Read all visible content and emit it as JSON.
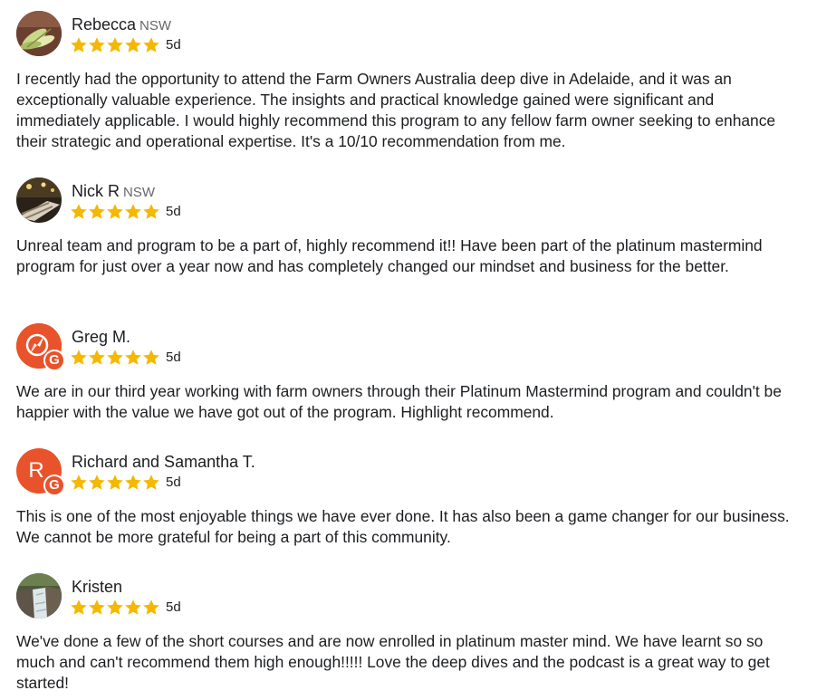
{
  "reviews": [
    {
      "name": "Rebecca",
      "region": "NSW",
      "rating": 5,
      "age": "5d",
      "avatar_icon": "leaves-photo-avatar",
      "text": "I recently had the opportunity to attend the Farm Owners Australia deep dive in Adelaide, and it was an exceptionally valuable experience. The insights and practical knowledge gained were significant and immediately applicable. I would highly recommend this program to any fellow farm owner seeking to enhance their strategic and operational expertise. It's a 10/10 recommendation from me."
    },
    {
      "name": "Nick R",
      "region": "NSW",
      "rating": 5,
      "age": "5d",
      "avatar_icon": "dark-photo-avatar",
      "text": "Unreal team and program to be a part of, highly recommend it!! Have been part of the platinum mastermind program for just over a year now and has completely changed our mindset and business for the better."
    },
    {
      "name": "Greg M.",
      "region": "",
      "rating": 5,
      "age": "5d",
      "avatar_icon": "compass-google-avatar",
      "text": "We are in our third year working with farm owners through their Platinum Mastermind program and couldn't be happier with the value we have got out of the program. Highlight recommend."
    },
    {
      "name": "Richard and Samantha T.",
      "region": "",
      "rating": 5,
      "age": "5d",
      "avatar_letter": "R",
      "avatar_icon": "letter-google-avatar",
      "text": "This is one of the most enjoyable things we have ever done. It has also been a game changer for our business. We cannot be more grateful for being a part of this community."
    },
    {
      "name": "Kristen",
      "region": "",
      "rating": 5,
      "age": "5d",
      "avatar_icon": "waterfall-photo-avatar",
      "text": "We've done a few of the short courses and are now enrolled in platinum master mind. We have learnt so so much and can't recommend them high enough!!!!! Love the deep dives and the podcast is a great way to get started!"
    }
  ],
  "badge": {
    "google_letter": "G"
  },
  "colors": {
    "star": "#f5b800",
    "google_badge": "#e8532b",
    "text": "#1c1e21",
    "muted": "#65676b"
  }
}
